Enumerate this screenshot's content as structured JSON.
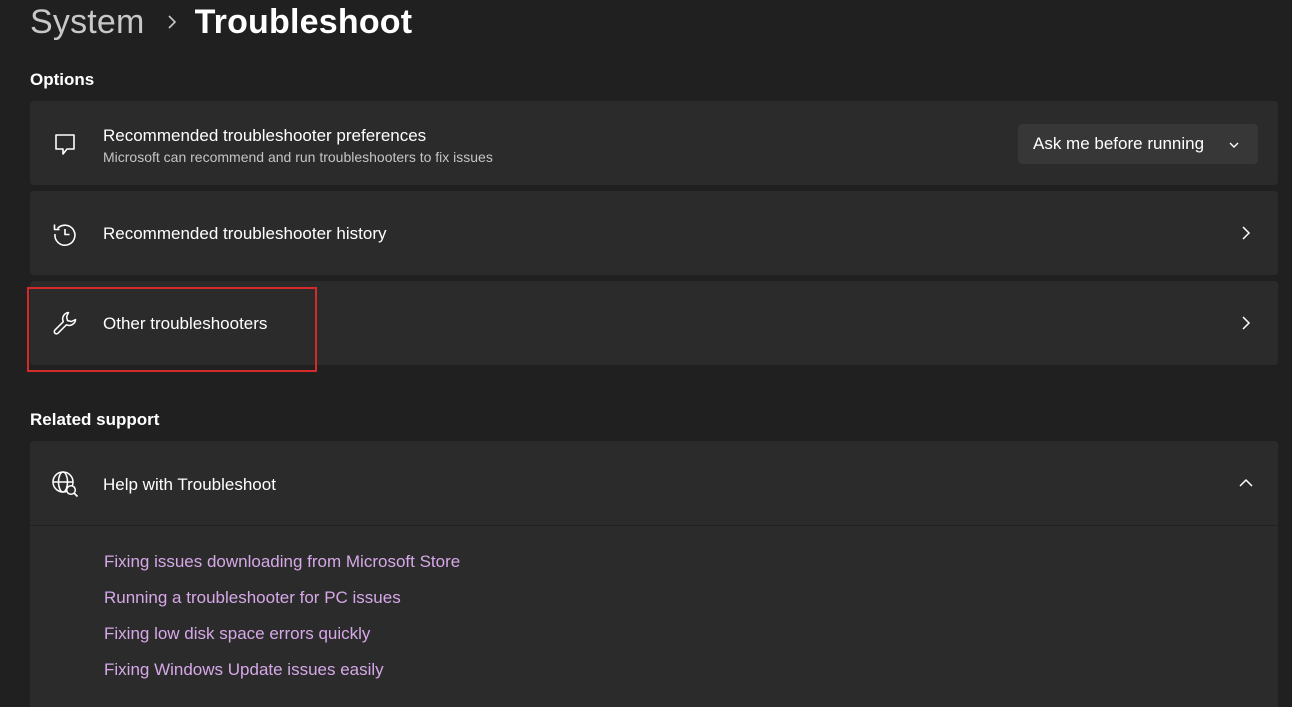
{
  "breadcrumb": {
    "parent": "System",
    "current": "Troubleshoot"
  },
  "options": {
    "heading": "Options",
    "preferences": {
      "title": "Recommended troubleshooter preferences",
      "subtitle": "Microsoft can recommend and run troubleshooters to fix issues",
      "dropdown_value": "Ask me before running",
      "icon": "chat-bubble-icon"
    },
    "history": {
      "title": "Recommended troubleshooter history",
      "icon": "history-icon"
    },
    "other": {
      "title": "Other troubleshooters",
      "icon": "wrench-icon"
    }
  },
  "related": {
    "heading": "Related support",
    "help": {
      "title": "Help with Troubleshoot",
      "icon": "globe-search-icon",
      "links": [
        "Fixing issues downloading from Microsoft Store",
        "Running a troubleshooter for PC issues",
        "Fixing low disk space errors quickly",
        "Fixing Windows Update issues easily"
      ]
    }
  },
  "colors": {
    "background": "#202020",
    "card": "#2b2b2b",
    "link": "#d6a8e8",
    "highlight": "#d42a2a"
  }
}
